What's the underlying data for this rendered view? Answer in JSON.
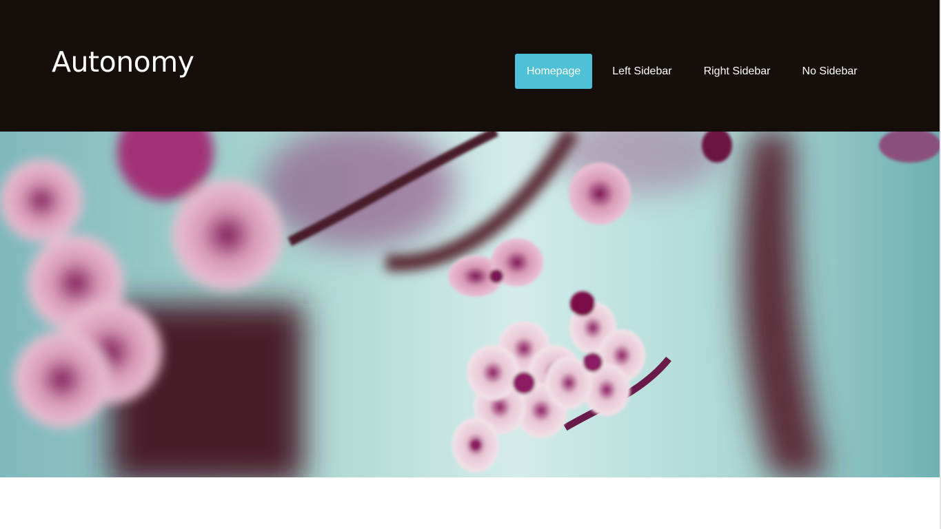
{
  "site": {
    "title": "Autonomy"
  },
  "nav": {
    "items": [
      {
        "label": "Homepage",
        "active": true
      },
      {
        "label": "Left Sidebar",
        "active": false
      },
      {
        "label": "Right Sidebar",
        "active": false
      },
      {
        "label": "No Sidebar",
        "active": false
      }
    ]
  },
  "colors": {
    "header_bg": "#150e0b",
    "accent": "#4fc1d6",
    "text": "#ffffff"
  },
  "hero": {
    "image": "cherry-blossom-photo"
  }
}
